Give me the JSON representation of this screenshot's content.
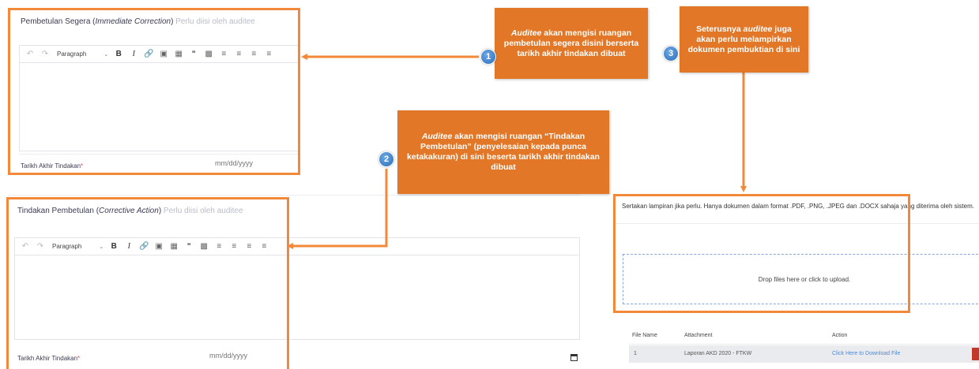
{
  "immediate": {
    "label_main": "Pembetulan Segera (",
    "label_em": "Immediate Correction",
    "label_close": ")",
    "label_hint": " Perlu diisi oleh auditee",
    "toolbar_paragraph": "Paragraph",
    "date_label": "Tarikh Akhir Tindakan",
    "date_required": "*",
    "date_placeholder": "mm/dd/yyyy"
  },
  "corrective": {
    "label_main": "Tindakan Pembetulan (",
    "label_em": "Corrective Action",
    "label_close": ")",
    "label_hint": " Perlu diisi oleh auditee",
    "toolbar_paragraph": "Paragraph",
    "date_label": "Tarikh Akhir Tindakan",
    "date_required": "*",
    "date_placeholder": "mm/dd/yyyy"
  },
  "attachment": {
    "instruction": "Sertakan lampiran jika perlu. Hanya dokumen dalam format .PDF, .PNG, .JPEG dan .DOCX sahaja yang diterima oleh sistem.",
    "dropzone_text": "Drop files here or click to upload.",
    "table": {
      "headers": [
        "File Name",
        "Attachment",
        "Action"
      ],
      "rows": [
        {
          "name": "1",
          "attachment": "Laporan AKD 2020 - FTKW",
          "action": "Click Here to Download File"
        }
      ]
    }
  },
  "callouts": {
    "one": {
      "number": "1",
      "em": "Auditee",
      "text": " akan mengisi ruangan pembetulan segera  disini berserta tarikh akhir tindakan dibuat"
    },
    "two": {
      "number": "2",
      "em": "Auditee",
      "text": " akan mengisi ruangan “Tindakan Pembetulan” (penyelesaian kepada punca ketakakuran)  di sini beserta tarikh akhir tindakan dibuat"
    },
    "three": {
      "number": "3",
      "pre": "Seterusnya ",
      "em": "auditee",
      "text": " juga akan perlu melampirkan dokumen pembuktian di sini"
    }
  },
  "colors": {
    "accent": "#e27727",
    "frame": "#f2883a",
    "badge": "#2d6fb8",
    "link": "#4f8ad8"
  },
  "icons": [
    "undo-icon",
    "redo-icon",
    "bold-icon",
    "italic-icon",
    "link-icon",
    "image-icon",
    "table-icon",
    "quote-icon",
    "media-icon",
    "bulleted-list-icon",
    "numbered-list-icon",
    "outdent-icon",
    "indent-icon",
    "calendar-icon",
    "arrow-icon"
  ]
}
